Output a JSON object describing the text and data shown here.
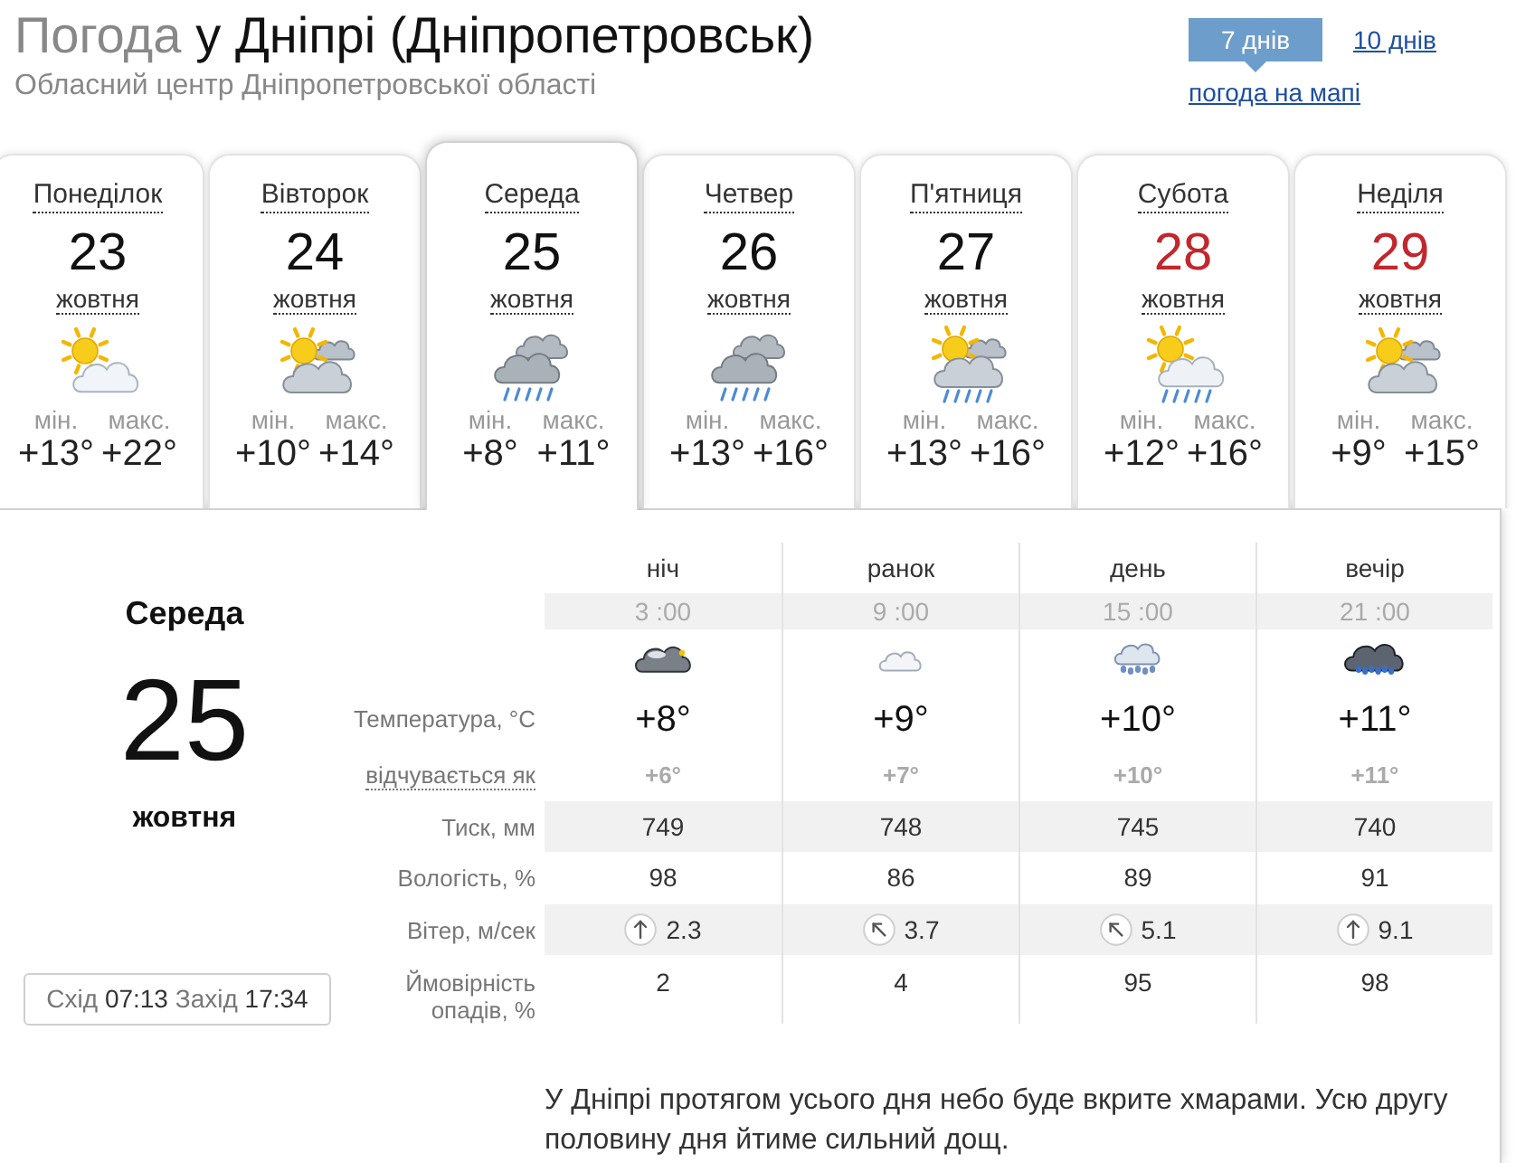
{
  "header": {
    "title_prefix": "Погода",
    "title_city": "у Дніпрі (Дніпропетровськ)",
    "subtitle": "Обласний центр Дніпропетровської області",
    "range_tabs": [
      {
        "label": "7 днів",
        "selected": true
      },
      {
        "label": "10 днів",
        "selected": false
      }
    ],
    "map_link": "погода на мапі"
  },
  "days": [
    {
      "name": "Понеділок",
      "date": "23",
      "month": "жовтня",
      "kind": "sun_cloud",
      "min_label": "мін.",
      "max_label": "макс.",
      "min": "+13°",
      "max": "+22°",
      "holiday": false,
      "selected": false
    },
    {
      "name": "Вівторок",
      "date": "24",
      "month": "жовтня",
      "kind": "sun_clouds",
      "min_label": "мін.",
      "max_label": "макс.",
      "min": "+10°",
      "max": "+14°",
      "holiday": false,
      "selected": false
    },
    {
      "name": "Середа",
      "date": "25",
      "month": "жовтня",
      "kind": "rain",
      "min_label": "мін.",
      "max_label": "макс.",
      "min": "+8°",
      "max": "+11°",
      "holiday": false,
      "selected": true
    },
    {
      "name": "Четвер",
      "date": "26",
      "month": "жовтня",
      "kind": "rain",
      "min_label": "мін.",
      "max_label": "макс.",
      "min": "+13°",
      "max": "+16°",
      "holiday": false,
      "selected": false
    },
    {
      "name": "П'ятниця",
      "date": "27",
      "month": "жовтня",
      "kind": "sun_clouds_rain",
      "min_label": "мін.",
      "max_label": "макс.",
      "min": "+13°",
      "max": "+16°",
      "holiday": false,
      "selected": false
    },
    {
      "name": "Субота",
      "date": "28",
      "month": "жовтня",
      "kind": "sun_cloud_rain",
      "min_label": "мін.",
      "max_label": "макс.",
      "min": "+12°",
      "max": "+16°",
      "holiday": true,
      "selected": false
    },
    {
      "name": "Неділя",
      "date": "29",
      "month": "жовтня",
      "kind": "sun_clouds",
      "min_label": "мін.",
      "max_label": "макс.",
      "min": "+9°",
      "max": "+15°",
      "holiday": true,
      "selected": false
    }
  ],
  "detail": {
    "weekday": "Середа",
    "date": "25",
    "month": "жовтня",
    "sun": {
      "sunrise_label": "Схід",
      "sunrise": "07:13",
      "sunset_label": "Захід",
      "sunset": "17:34"
    },
    "row_labels": [
      "Температура, °C",
      "відчувається як",
      "Тиск, мм",
      "Вологість, %",
      "Вітер, м/сек",
      "Ймовірність опадів, %"
    ],
    "periods": [
      {
        "name": "ніч",
        "time": "3 :00",
        "kind": "night_cloud",
        "temp": "+8°",
        "feels": "+6°",
        "pressure": "749",
        "humidity": "98",
        "wind": {
          "kind": "up",
          "speed": "2.3"
        },
        "precip": "2"
      },
      {
        "name": "ранок",
        "time": "9 :00",
        "kind": "cloud",
        "temp": "+9°",
        "feels": "+7°",
        "pressure": "748",
        "humidity": "86",
        "wind": {
          "kind": "up_left",
          "speed": "3.7"
        },
        "precip": "4"
      },
      {
        "name": "день",
        "time": "15 :00",
        "kind": "cloud_rain",
        "temp": "+10°",
        "feels": "+10°",
        "pressure": "745",
        "humidity": "89",
        "wind": {
          "kind": "up_left",
          "speed": "5.1"
        },
        "precip": "95"
      },
      {
        "name": "вечір",
        "time": "21 :00",
        "kind": "night_rain",
        "temp": "+11°",
        "feels": "+11°",
        "pressure": "740",
        "humidity": "91",
        "wind": {
          "kind": "up",
          "speed": "9.1"
        },
        "precip": "98"
      }
    ],
    "description": "У Дніпрі протягом усього дня небо буде вкрите хмарами. Усю другу половину дня йтиме сильний дощ."
  }
}
